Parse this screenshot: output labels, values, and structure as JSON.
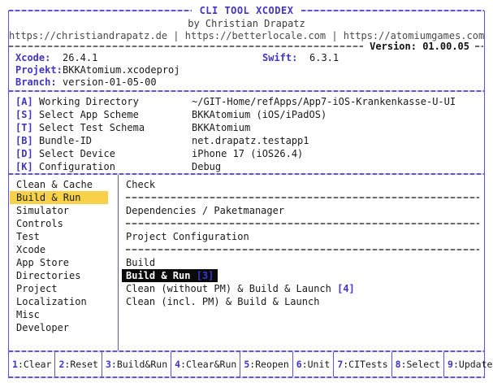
{
  "colors": {
    "accent_blue": "#4035c8",
    "border_blue": "#5b55d6",
    "highlight_yellow": "#f7d147",
    "selected_item_bg": "#0a0a0a",
    "separator_gray": "#6b6b6b"
  },
  "header": {
    "title": "CLI TOOL XCODEX",
    "byline": "by Christian Drapatz",
    "links": "https://christiandrapatz.de | https://betterlocale.com | https://atomiumgames.com",
    "version_label": "Version: 01.00.05"
  },
  "info": {
    "rows": [
      {
        "label": "Xcode:",
        "value": "26.4.1",
        "label2": "Swift:",
        "value2": "6.3.1"
      },
      {
        "label": "Projekt:",
        "value": "BKKAtomium.xcodeproj"
      },
      {
        "label": "Branch:",
        "value": "version-01-05-00"
      }
    ]
  },
  "shortcuts": [
    {
      "key": "[A]",
      "label": "Working Directory",
      "value": "~/GIT-Home/refApps/App7-iOS-Krankenkasse-U-UI"
    },
    {
      "key": "[S]",
      "label": "Select App Scheme",
      "value": "BKKAtomium (iOS/iPadOS)"
    },
    {
      "key": "[T]",
      "label": "Select Test Schema",
      "value": "BKKAtomium"
    },
    {
      "key": "[B]",
      "label": "Bundle-ID",
      "value": "net.drapatz.testapp1"
    },
    {
      "key": "[D]",
      "label": "Select Device",
      "value": "iPhone 17 (iOS26.4)"
    },
    {
      "key": "[K]",
      "label": "Configuration",
      "value": "Debug"
    }
  ],
  "menu": {
    "selected": "Build & Run",
    "items": [
      "Clean & Cache",
      "Build & Run",
      "Simulator",
      "Controls",
      "Test",
      "Xcode",
      "App Store",
      "Directories",
      "Project",
      "Localization",
      "Misc",
      "Developer"
    ]
  },
  "content": {
    "rows": [
      {
        "type": "item",
        "text": "Check"
      },
      {
        "type": "sep"
      },
      {
        "type": "item",
        "text": "Dependencies / Paketmanager"
      },
      {
        "type": "sep"
      },
      {
        "type": "item",
        "text": "Project Configuration"
      },
      {
        "type": "sep"
      },
      {
        "type": "item",
        "text": "Build"
      },
      {
        "type": "item",
        "text": "Build & Run",
        "badge": "[3]",
        "selected": true
      },
      {
        "type": "item",
        "text": "Clean (without PM) & Build & Launch",
        "badge": "[4]"
      },
      {
        "type": "item",
        "text": "Clean (incl. PM) & Build & Launch"
      }
    ]
  },
  "fnbar": [
    {
      "key": "1",
      "label": "Clear"
    },
    {
      "key": "2",
      "label": "Reset"
    },
    {
      "key": "3",
      "label": "Build&Run"
    },
    {
      "key": "4",
      "label": "Clear&Run"
    },
    {
      "key": "5",
      "label": "Reopen"
    },
    {
      "key": "6",
      "label": "Unit"
    },
    {
      "key": "7",
      "label": "CITests"
    },
    {
      "key": "8",
      "label": "Select"
    },
    {
      "key": "9",
      "label": "Update"
    }
  ]
}
